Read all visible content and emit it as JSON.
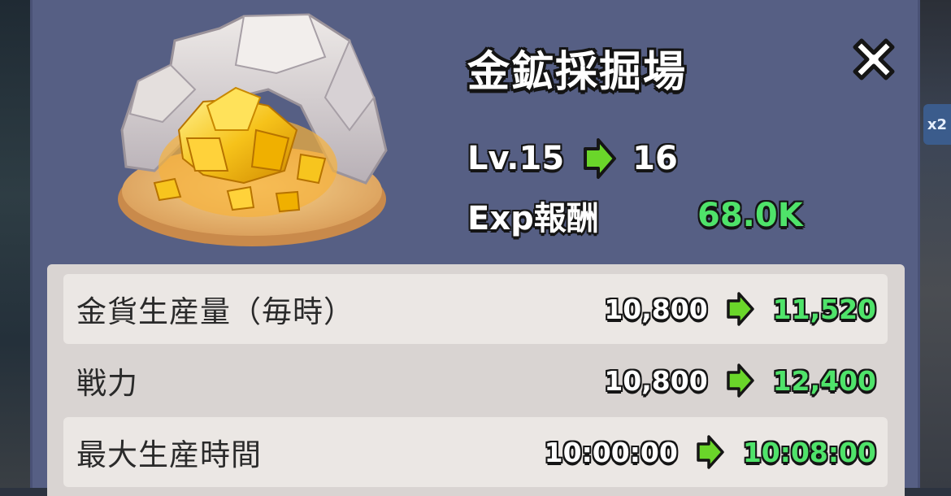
{
  "building": {
    "title": "金鉱採掘場",
    "level_prefix": "Lv.15",
    "level_next": "16",
    "exp_label": "Exp報酬",
    "exp_value": "68.0K"
  },
  "stats": [
    {
      "label": "金貨生産量（毎時）",
      "current": "10,800",
      "next": "11,520"
    },
    {
      "label": "戦力",
      "current": "10,800",
      "next": "12,400"
    },
    {
      "label": "最大生産時間",
      "current": "10:00:00",
      "next": "10:08:00"
    }
  ],
  "background": {
    "badge_text": "x2"
  },
  "icons": {
    "close": "close-icon",
    "upgrade_arrow": "arrow-right-icon",
    "building_art": "gold-mine-icon"
  },
  "colors": {
    "panel": "#565f84",
    "value_green": "#4fe36a",
    "arrow_green": "#6ad62a",
    "stats_bg": "#d9d4d2"
  }
}
